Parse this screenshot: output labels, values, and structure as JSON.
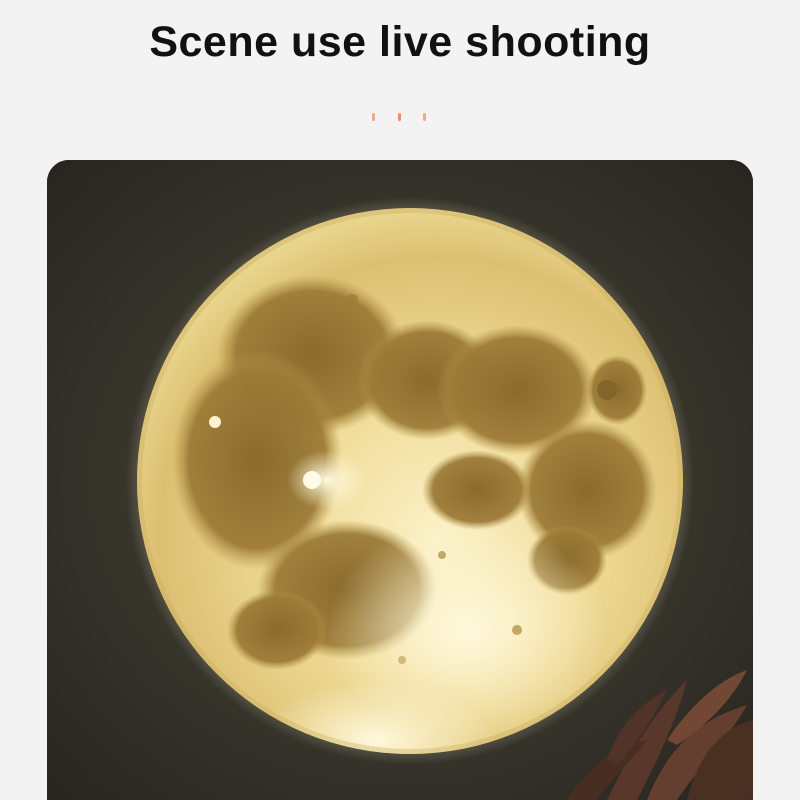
{
  "header": {
    "title": "Scene use live shooting"
  },
  "decor": {
    "dot_colors": [
      "#f2a58f",
      "#ee8c75",
      "#f2a58f"
    ]
  },
  "photo": {
    "subject": "moon-projection",
    "colors": {
      "wall_dark": "#2b2922",
      "wall_light": "#4a463b",
      "moon_light": "#f3e4a6",
      "moon_mid": "#d9bd70",
      "moon_dark": "#8e7132",
      "plant": "#5e3a2c"
    }
  }
}
